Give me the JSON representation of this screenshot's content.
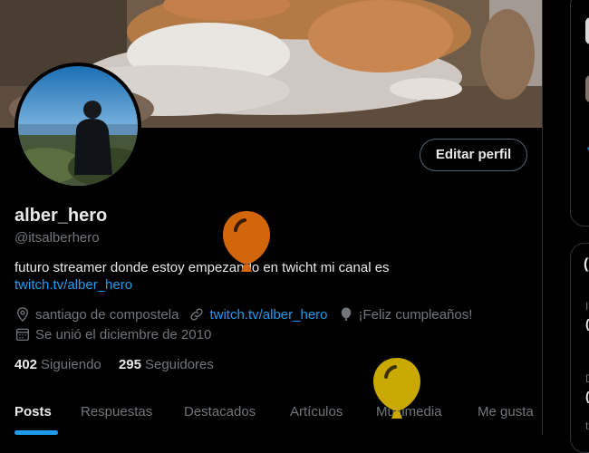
{
  "profile": {
    "edit_button": "Editar perfil",
    "display_name": "alber_hero",
    "handle": "@itsalberhero",
    "bio": "futuro streamer donde estoy empezando en twicht mi canal es",
    "bio_link": "twitch.tv/alber_hero",
    "location": "santiago de compostela",
    "website": "twitch.tv/alber_hero",
    "birthday": "¡Feliz cumpleaños!",
    "joined": "Se unió el diciembre de 2010",
    "following_count": "402",
    "following_label": "Siguiendo",
    "followers_count": "295",
    "followers_label": "Seguidores"
  },
  "tabs": [
    "Posts",
    "Respuestas",
    "Destacados",
    "Artículos",
    "Multimedia",
    "Me gusta"
  ],
  "active_tab": 0,
  "colors": {
    "accent": "#1d9bf0",
    "balloon_orange": "#d2660a",
    "balloon_yellow": "#c9a800",
    "muted_text": "#71767b"
  },
  "icons": [
    "location-pin-icon",
    "link-icon",
    "balloon-icon",
    "calendar-icon"
  ]
}
